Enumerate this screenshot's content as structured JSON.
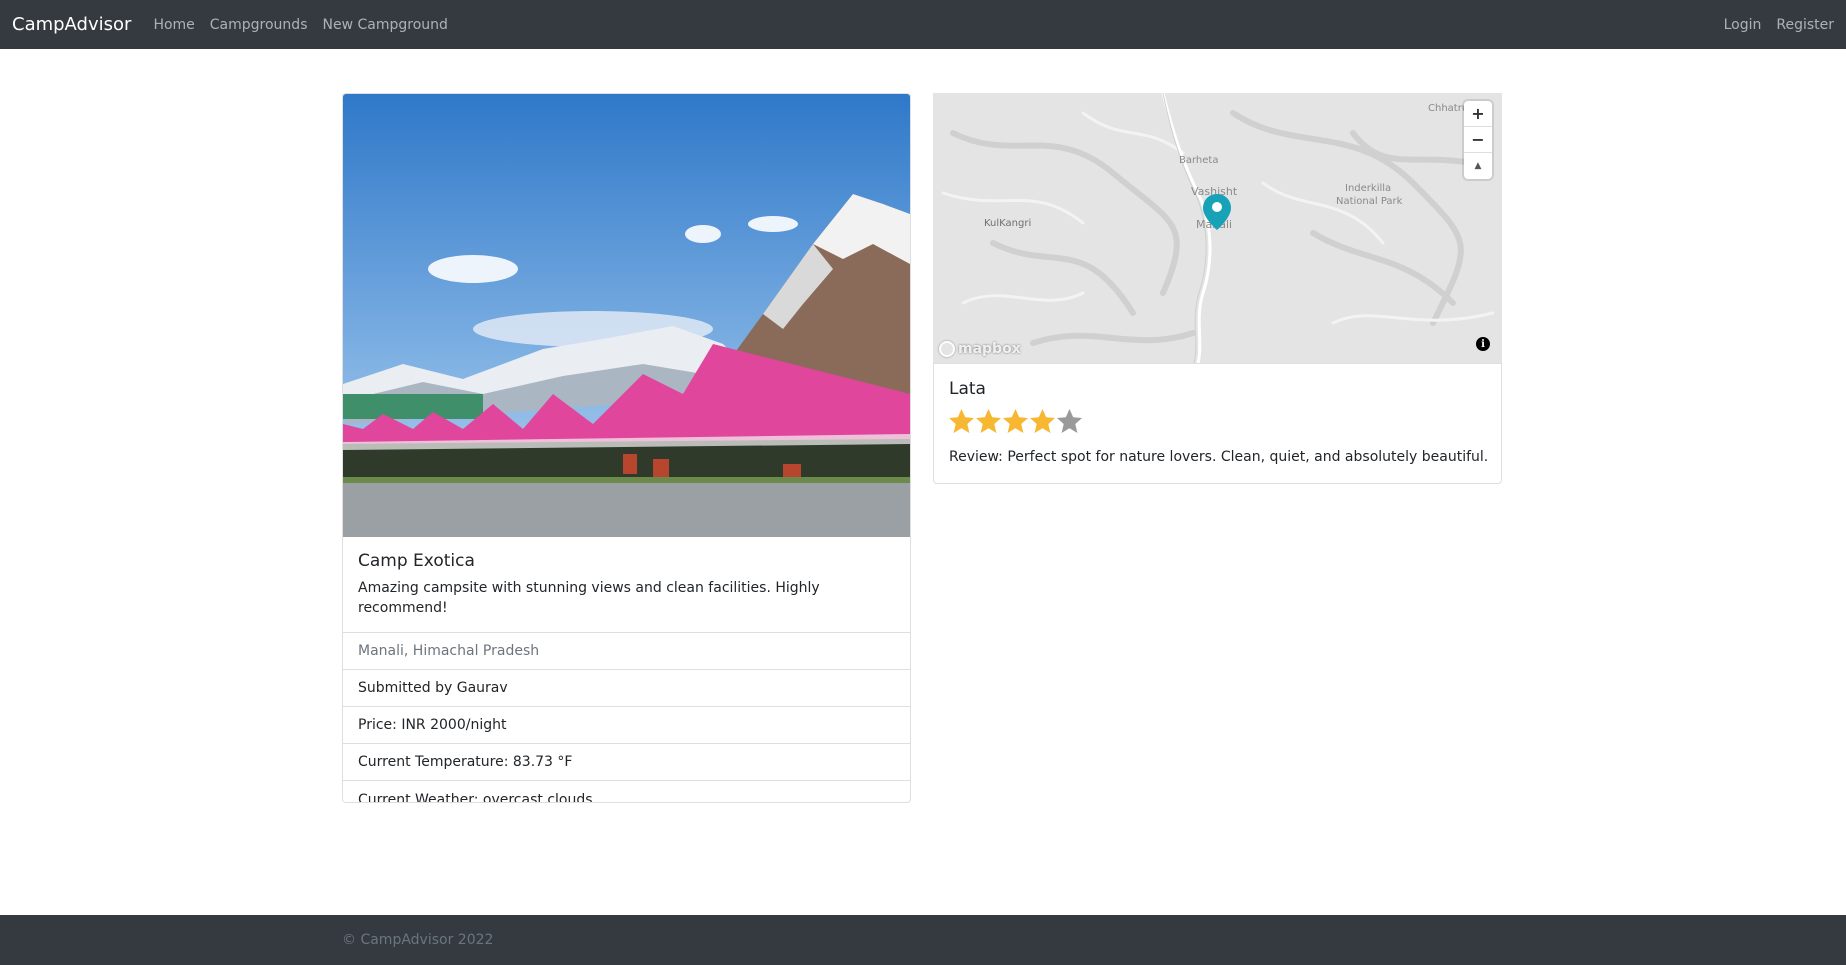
{
  "navbar": {
    "brand": "CampAdvisor",
    "links": [
      "Home",
      "Campgrounds",
      "New Campground"
    ],
    "auth": [
      "Login",
      "Register"
    ]
  },
  "campground": {
    "title": "Camp Exotica",
    "description": "Amazing campsite with stunning views and clean facilities. Highly recommend!",
    "location": "Manali, Himachal Pradesh",
    "submitted_by": "Submitted by Gaurav",
    "price": "Price: INR 2000/night",
    "temperature": "Current Temperature: 83.73 °F",
    "weather": "Current Weather: overcast clouds"
  },
  "map": {
    "labels": [
      "Chhatru",
      "Barheta",
      "Vashisht",
      "Manali",
      "KulKangri",
      "Inderkilla",
      "National Park"
    ],
    "zoom_in": "+",
    "zoom_out": "−",
    "compass": "▲",
    "logo": "mapbox",
    "info": "i"
  },
  "review": {
    "author": "Lata",
    "rating": 4,
    "max_rating": 5,
    "text": "Review: Perfect spot for nature lovers. Clean, quiet, and absolutely beautiful."
  },
  "footer": {
    "text": "© CampAdvisor 2022"
  },
  "colors": {
    "nav_bg": "#343a40",
    "star_filled": "#f7b731",
    "star_empty": "#9a9a9a",
    "marker": "#17a2b8"
  }
}
